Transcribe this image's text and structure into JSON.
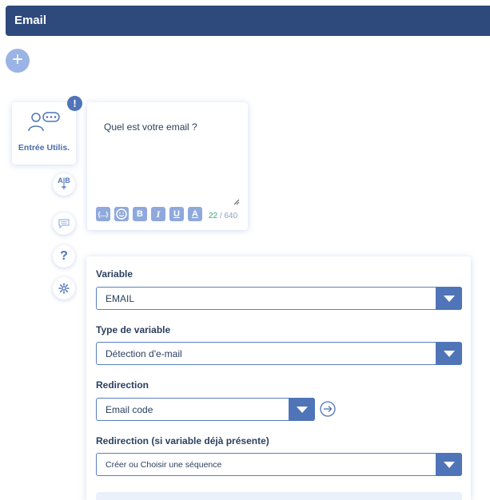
{
  "header": {
    "title": "Email"
  },
  "add_button": {
    "glyph": "+"
  },
  "user_input_card": {
    "label": "Entrée Utilis.",
    "alert": "!"
  },
  "side_actions": {
    "ab_top": "A|B",
    "ab_bottom": "+",
    "help": "?"
  },
  "message": {
    "text": "Quel est votre email ?",
    "toolbar": {
      "variable": "{...}",
      "bold": "B",
      "italic": "I",
      "underline": "U",
      "color": "A"
    },
    "char_count": "22",
    "char_max": "/ 640"
  },
  "form": {
    "variable": {
      "label": "Variable",
      "value": "EMAIL"
    },
    "variable_type": {
      "label": "Type de variable",
      "value": "Détection d'e-mail"
    },
    "redirection": {
      "label": "Redirection",
      "value": "Email code"
    },
    "redirection_if_present": {
      "label": "Redirection (si variable déjà présente)",
      "value": "Créer ou Choisir une séquence"
    }
  },
  "colors": {
    "header": "#2e4a7d",
    "accent": "#4f74b8",
    "light_accent": "#9bb4e6"
  }
}
